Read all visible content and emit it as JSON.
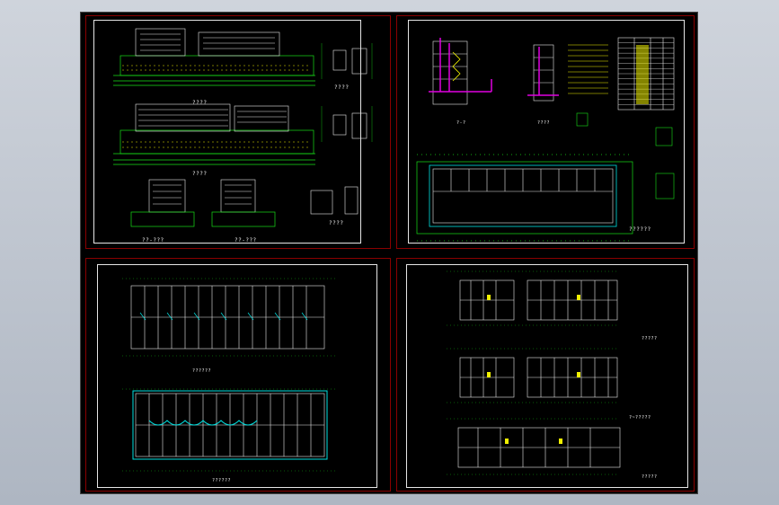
{
  "colors": {
    "background": "#000000",
    "sheet_border": "#8a0000",
    "frame": "#e6e6e6",
    "line_green": "#18e018",
    "line_white": "#e8e8e8",
    "line_yellow": "#f0f000",
    "line_magenta": "#e000e0",
    "line_cyan": "#00e0e0"
  },
  "sheets": [
    {
      "name": "elevations",
      "labels": [
        "????",
        "????",
        "??-???",
        "??-???",
        "????",
        "????"
      ]
    },
    {
      "name": "sections-and-details",
      "labels": [
        "?-?",
        "????",
        "??????"
      ],
      "table_rows": 14
    },
    {
      "name": "floor-plans-a",
      "labels": [
        "??????",
        "??????"
      ]
    },
    {
      "name": "floor-plans-b",
      "labels": [
        "?????",
        "?~?????",
        "?????"
      ]
    }
  ]
}
